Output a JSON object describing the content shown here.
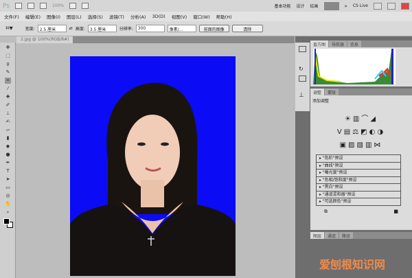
{
  "appbar": {
    "logo": "Ps",
    "zoom": "100%",
    "workspaces": [
      "基本功能",
      "设计",
      "绘画"
    ],
    "cslive": "CS Live"
  },
  "menu": [
    "文件(F)",
    "编辑(E)",
    "图像(I)",
    "图层(L)",
    "选择(S)",
    "滤镜(T)",
    "分析(A)",
    "3D(D)",
    "视图(V)",
    "窗口(W)",
    "帮助(H)"
  ],
  "options": {
    "width_label": "宽度:",
    "width": "2.5 厘米",
    "height_label": "高度:",
    "height": "3.5 厘米",
    "res_label": "分辨率:",
    "res": "300",
    "unit": "像素/...",
    "front_btn": "前面的图像",
    "clear_btn": "清除"
  },
  "document": {
    "tab": "2.jpg @ 100%(RGB/8#)",
    "bg_color": "#0b0bf5"
  },
  "panels": {
    "top_tabs": [
      "直方图",
      "导航器",
      "信息"
    ],
    "adj_tabs": [
      "调整",
      "蒙版"
    ],
    "adj_title": "添加调整",
    "presets": [
      "\"色阶\"预设",
      "\"曲线\"预设",
      "\"曝光度\"预设",
      "\"色相/饱和度\"预设",
      "\"黑白\"预设",
      "\"通道混和器\"预设",
      "\"可选颜色\"预设"
    ],
    "layer_tabs": [
      "图层",
      "通道",
      "路径"
    ]
  },
  "watermark": "爱刨根知识网"
}
